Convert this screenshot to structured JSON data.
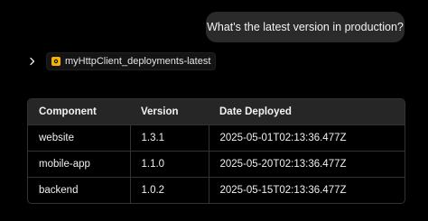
{
  "user_message": "What's the latest version in production?",
  "tool_call": {
    "name": "myHttpClient_deployments-latest",
    "icon": "tool-icon",
    "expand_icon": "chevron-right-icon"
  },
  "table": {
    "headers": [
      "Component",
      "Version",
      "Date Deployed"
    ],
    "rows": [
      [
        "website",
        "1.3.1",
        "2025-05-01T02:13:36.477Z"
      ],
      [
        "mobile-app",
        "1.1.0",
        "2025-05-20T02:13:36.477Z"
      ],
      [
        "backend",
        "1.0.2",
        "2025-05-15T02:13:36.477Z"
      ]
    ]
  },
  "colors": {
    "background": "#000000",
    "bubble": "#2a2a2a",
    "table_header": "#262626",
    "border": "#333333",
    "tool_icon_accent": "#f5b400"
  }
}
